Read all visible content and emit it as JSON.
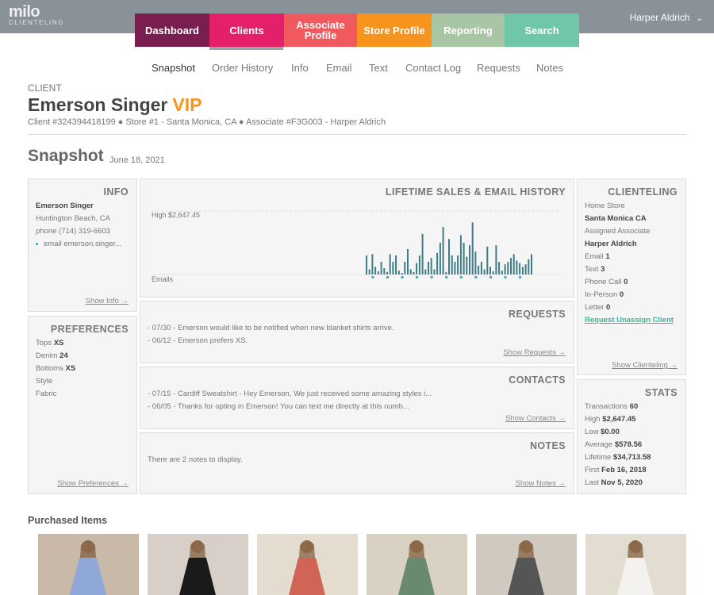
{
  "app": {
    "logo_main": "milo",
    "logo_sub": "CLIENTELING",
    "user_name": "Harper Aldrich"
  },
  "nav": [
    {
      "label": "Dashboard",
      "color": "#7a1e50"
    },
    {
      "label": "Clients",
      "color": "#e5206b"
    },
    {
      "label": "Associate Profile",
      "color": "#f05a5e"
    },
    {
      "label": "Store Profile",
      "color": "#f7941d"
    },
    {
      "label": "Reporting",
      "color": "#a8c6a3"
    },
    {
      "label": "Search",
      "color": "#6fc7a8"
    }
  ],
  "subnav": [
    "Snapshot",
    "Order History",
    "Info",
    "Email",
    "Text",
    "Contact Log",
    "Requests",
    "Notes"
  ],
  "client": {
    "label": "CLIENT",
    "name": "Emerson Singer",
    "badge": "VIP",
    "meta": "Client #324394418199 ● Store #1 - Santa Monica, CA ● Associate #F3G003 - Harper Aldrich"
  },
  "snapshot": {
    "title": "Snapshot",
    "date": "June 18, 2021"
  },
  "info": {
    "title": "INFO",
    "name": "Emerson Singer",
    "location": "Huntington Beach, CA",
    "phone": "phone (714) 319-6603",
    "email": "email emerson.singer...",
    "link": "Show Info →"
  },
  "preferences": {
    "title": "PREFERENCES",
    "items": [
      {
        "label": "Tops",
        "value": "XS"
      },
      {
        "label": "Denim",
        "value": "24"
      },
      {
        "label": "Bottoms",
        "value": "XS"
      },
      {
        "label": "Style",
        "value": ""
      },
      {
        "label": "Fabric",
        "value": ""
      }
    ],
    "link": "Show Preferences →"
  },
  "chart_data": {
    "type": "bar",
    "title": "LIFETIME SALES & EMAIL HISTORY",
    "high_label": "High $2,647.45",
    "emails_label": "Emails",
    "ylim": [
      0,
      2647.45
    ],
    "values": [
      0.3,
      0.08,
      0.32,
      0.12,
      0.05,
      0.2,
      0.1,
      0.04,
      0.32,
      0.2,
      0.3,
      0.06,
      0.02,
      0.2,
      0.4,
      0.08,
      0.04,
      0.18,
      0.3,
      0.64,
      0.08,
      0.2,
      0.26,
      0.08,
      0.34,
      0.5,
      0.75,
      0.04,
      0.56,
      0.3,
      0.2,
      0.3,
      0.62,
      0.5,
      0.28,
      0.46,
      0.82,
      0.36,
      0.14,
      0.2,
      0.08,
      0.44,
      0.12,
      0.05,
      0.46,
      0.2,
      0.06,
      0.16,
      0.2,
      0.26,
      0.32,
      0.22,
      0.18,
      0.12,
      0.16,
      0.24,
      0.32
    ]
  },
  "requests": {
    "title": "REQUESTS",
    "items": [
      "- 07/30 - Emerson would like to be notified when new blanket shirts arrive.",
      "- 06/12 - Emerson prefers XS."
    ],
    "link": "Show Requests →"
  },
  "contacts": {
    "title": "CONTACTS",
    "items": [
      "- 07/15 - Cardiff Sweatshirt - Hey Emerson, We just received some amazing styles i...",
      "- 06/05 - Thanks for opting in Emerson! You can text me directly at this numb..."
    ],
    "link": "Show Contacts →"
  },
  "notes": {
    "title": "NOTES",
    "text": "There are 2 notes to display.",
    "link": "Show Notes →"
  },
  "clienteling": {
    "title": "CLIENTELING",
    "home_store_label": "Home Store",
    "home_store": "Santa Monica CA",
    "associate_label": "Assigned Associate",
    "associate": "Harper Aldrich",
    "counts": [
      {
        "label": "Email",
        "value": "1"
      },
      {
        "label": "Text",
        "value": "3"
      },
      {
        "label": "Phone Call",
        "value": "0"
      },
      {
        "label": "In-Person",
        "value": "0"
      },
      {
        "label": "Letter",
        "value": "0"
      }
    ],
    "unassign": "Request Unassign Client",
    "link": "Show Clienteling →"
  },
  "stats": {
    "title": "STATS",
    "items": [
      {
        "label": "Transactions",
        "value": "60"
      },
      {
        "label": "High",
        "value": "$2,647.45"
      },
      {
        "label": "Low",
        "value": "$0.00"
      },
      {
        "label": "Average",
        "value": "$578.56"
      },
      {
        "label": "Lifetime",
        "value": "$34,713.58"
      },
      {
        "label": "First",
        "value": "Feb 16, 2018"
      },
      {
        "label": "Last",
        "value": "Nov 5, 2020"
      }
    ]
  },
  "purchased": {
    "title": "Purchased Items",
    "items": [
      {
        "bg": "#c9b9a8",
        "dress": "#8fa8d8"
      },
      {
        "bg": "#d8d0c8",
        "dress": "#1a1a1a"
      },
      {
        "bg": "#e4dccf",
        "dress": "#d06455"
      },
      {
        "bg": "#d9d2c2",
        "dress": "#6a8a70"
      },
      {
        "bg": "#cfc9c0",
        "dress": "#555555"
      },
      {
        "bg": "#e2ddd0",
        "dress": "#f4f2ee"
      }
    ]
  }
}
